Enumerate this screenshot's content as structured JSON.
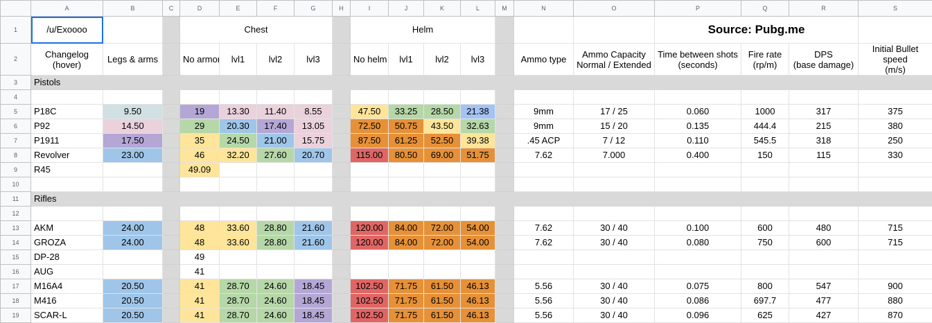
{
  "col_letters": [
    "A",
    "B",
    "C",
    "D",
    "E",
    "F",
    "G",
    "H",
    "I",
    "J",
    "K",
    "L",
    "M",
    "N",
    "O",
    "P",
    "Q",
    "R",
    "S"
  ],
  "header1": {
    "a1": "/u/Exoooo",
    "chest": "Chest",
    "helm": "Helm",
    "source": "Source: Pubg.me"
  },
  "header2": {
    "a2": "Changelog\n(hover)",
    "b": "Legs & arms",
    "d": "No armor",
    "e": "lvl1",
    "f": "lvl2",
    "g": "lvl3",
    "i": "No helm",
    "j": "lvl1",
    "k": "lvl2",
    "l": "lvl3",
    "n": "Ammo type",
    "o": "Ammo Capacity\nNormal / Extended",
    "p": "Time between shots\n(seconds)",
    "q": "Fire rate\n(rp/m)",
    "r": "DPS\n(base damage)",
    "s": "Initial Bullet speed\n(m/s)"
  },
  "sections": {
    "pistols": "Pistols",
    "rifles": "Rifles"
  },
  "row_numbers": [
    "1",
    "2",
    "3",
    "4",
    "5",
    "6",
    "7",
    "8",
    "9",
    "10",
    "11",
    "12",
    "13",
    "14",
    "15",
    "16",
    "17",
    "18",
    "19"
  ],
  "pistols": [
    {
      "row": "5",
      "name": "P18C",
      "b": "9.50",
      "d": "19",
      "e": "13.30",
      "f": "11.40",
      "g": "8.55",
      "i": "47.50",
      "j": "33.25",
      "k": "28.50",
      "l": "21.38",
      "n": "9mm",
      "o": "17 / 25",
      "p": "0.060",
      "q": "1000",
      "r": "317",
      "s": "375",
      "colors": {
        "b": "#d0e0e3",
        "d": "#b4a7d6",
        "e": "#ead1dc",
        "f": "#ead1dc",
        "g": "#ead1dc",
        "i": "#ffe599",
        "j": "#b6d7a8",
        "k": "#b6d7a8",
        "l": "#a4c2f4"
      }
    },
    {
      "row": "6",
      "name": "P92",
      "b": "14.50",
      "d": "29",
      "e": "20.30",
      "f": "17.40",
      "g": "13.05",
      "i": "72.50",
      "j": "50.75",
      "k": "43.50",
      "l": "32.63",
      "n": "9mm",
      "o": "15 / 20",
      "p": "0.135",
      "q": "444.4",
      "r": "215",
      "s": "380",
      "colors": {
        "b": "#ead1dc",
        "d": "#b6d7a8",
        "e": "#9fc5e8",
        "f": "#b4a7d6",
        "g": "#ead1dc",
        "i": "#e69138",
        "j": "#e69138",
        "k": "#ffe599",
        "l": "#b6d7a8"
      }
    },
    {
      "row": "7",
      "name": "P1911",
      "b": "17.50",
      "d": "35",
      "e": "24.50",
      "f": "21.00",
      "g": "15.75",
      "i": "87.50",
      "j": "61.25",
      "k": "52.50",
      "l": "39.38",
      "n": ".45 ACP",
      "o": "7 / 12",
      "p": "0.110",
      "q": "545.5",
      "r": "318",
      "s": "250",
      "colors": {
        "b": "#b4a7d6",
        "d": "#ffe599",
        "e": "#b6d7a8",
        "f": "#9fc5e8",
        "g": "#ead1dc",
        "i": "#e69138",
        "j": "#e69138",
        "k": "#e69138",
        "l": "#ffe599"
      }
    },
    {
      "row": "8",
      "name": "Revolver",
      "b": "23.00",
      "d": "46",
      "e": "32.20",
      "f": "27.60",
      "g": "20.70",
      "i": "115.00",
      "j": "80.50",
      "k": "69.00",
      "l": "51.75",
      "n": "7.62",
      "o": "7.000",
      "p": "0.400",
      "q": "150",
      "r": "115",
      "s": "330",
      "colors": {
        "b": "#9fc5e8",
        "d": "#ffe599",
        "e": "#ffe599",
        "f": "#b6d7a8",
        "g": "#9fc5e8",
        "i": "#e06666",
        "j": "#e69138",
        "k": "#e69138",
        "l": "#e69138"
      }
    },
    {
      "row": "9",
      "name": "R45",
      "b": "",
      "d": "49.09",
      "e": "",
      "f": "",
      "g": "",
      "i": "",
      "j": "",
      "k": "",
      "l": "",
      "n": "",
      "o": "",
      "p": "",
      "q": "",
      "r": "",
      "s": "",
      "colors": {
        "d": "#ffe599"
      }
    }
  ],
  "rifles": [
    {
      "row": "13",
      "name": "AKM",
      "b": "24.00",
      "d": "48",
      "e": "33.60",
      "f": "28.80",
      "g": "21.60",
      "i": "120.00",
      "j": "84.00",
      "k": "72.00",
      "l": "54.00",
      "n": "7.62",
      "o": "30 / 40",
      "p": "0.100",
      "q": "600",
      "r": "480",
      "s": "715",
      "colors": {
        "b": "#9fc5e8",
        "d": "#ffe599",
        "e": "#ffe599",
        "f": "#b6d7a8",
        "g": "#9fc5e8",
        "i": "#e06666",
        "j": "#e69138",
        "k": "#e69138",
        "l": "#e69138"
      }
    },
    {
      "row": "14",
      "name": "GROZA",
      "b": "24.00",
      "d": "48",
      "e": "33.60",
      "f": "28.80",
      "g": "21.60",
      "i": "120.00",
      "j": "84.00",
      "k": "72.00",
      "l": "54.00",
      "n": "7.62",
      "o": "30 / 40",
      "p": "0.080",
      "q": "750",
      "r": "600",
      "s": "715",
      "colors": {
        "b": "#9fc5e8",
        "d": "#ffe599",
        "e": "#ffe599",
        "f": "#b6d7a8",
        "g": "#9fc5e8",
        "i": "#e06666",
        "j": "#e69138",
        "k": "#e69138",
        "l": "#e69138"
      }
    },
    {
      "row": "15",
      "name": "DP-28",
      "b": "",
      "d": "49",
      "e": "",
      "f": "",
      "g": "",
      "i": "",
      "j": "",
      "k": "",
      "l": "",
      "n": "",
      "o": "",
      "p": "",
      "q": "",
      "r": "",
      "s": "",
      "colors": {}
    },
    {
      "row": "16",
      "name": "AUG",
      "b": "",
      "d": "41",
      "e": "",
      "f": "",
      "g": "",
      "i": "",
      "j": "",
      "k": "",
      "l": "",
      "n": "",
      "o": "",
      "p": "",
      "q": "",
      "r": "",
      "s": "",
      "colors": {}
    },
    {
      "row": "17",
      "name": "M16A4",
      "b": "20.50",
      "d": "41",
      "e": "28.70",
      "f": "24.60",
      "g": "18.45",
      "i": "102.50",
      "j": "71.75",
      "k": "61.50",
      "l": "46.13",
      "n": "5.56",
      "o": "30 / 40",
      "p": "0.075",
      "q": "800",
      "r": "547",
      "s": "900",
      "colors": {
        "b": "#9fc5e8",
        "d": "#ffe599",
        "e": "#b6d7a8",
        "f": "#b6d7a8",
        "g": "#b4a7d6",
        "i": "#e06666",
        "j": "#e69138",
        "k": "#e69138",
        "l": "#e69138"
      }
    },
    {
      "row": "18",
      "name": "M416",
      "b": "20.50",
      "d": "41",
      "e": "28.70",
      "f": "24.60",
      "g": "18.45",
      "i": "102.50",
      "j": "71.75",
      "k": "61.50",
      "l": "46.13",
      "n": "5.56",
      "o": "30 / 40",
      "p": "0.086",
      "q": "697.7",
      "r": "477",
      "s": "880",
      "colors": {
        "b": "#9fc5e8",
        "d": "#ffe599",
        "e": "#b6d7a8",
        "f": "#b6d7a8",
        "g": "#b4a7d6",
        "i": "#e06666",
        "j": "#e69138",
        "k": "#e69138",
        "l": "#e69138"
      }
    },
    {
      "row": "19",
      "name": "SCAR-L",
      "b": "20.50",
      "d": "41",
      "e": "28.70",
      "f": "24.60",
      "g": "18.45",
      "i": "102.50",
      "j": "71.75",
      "k": "61.50",
      "l": "46.13",
      "n": "5.56",
      "o": "30 / 40",
      "p": "0.096",
      "q": "625",
      "r": "427",
      "s": "870",
      "colors": {
        "b": "#9fc5e8",
        "d": "#ffe599",
        "e": "#b6d7a8",
        "f": "#b6d7a8",
        "g": "#b4a7d6",
        "i": "#e06666",
        "j": "#e69138",
        "k": "#e69138",
        "l": "#e69138"
      }
    }
  ]
}
